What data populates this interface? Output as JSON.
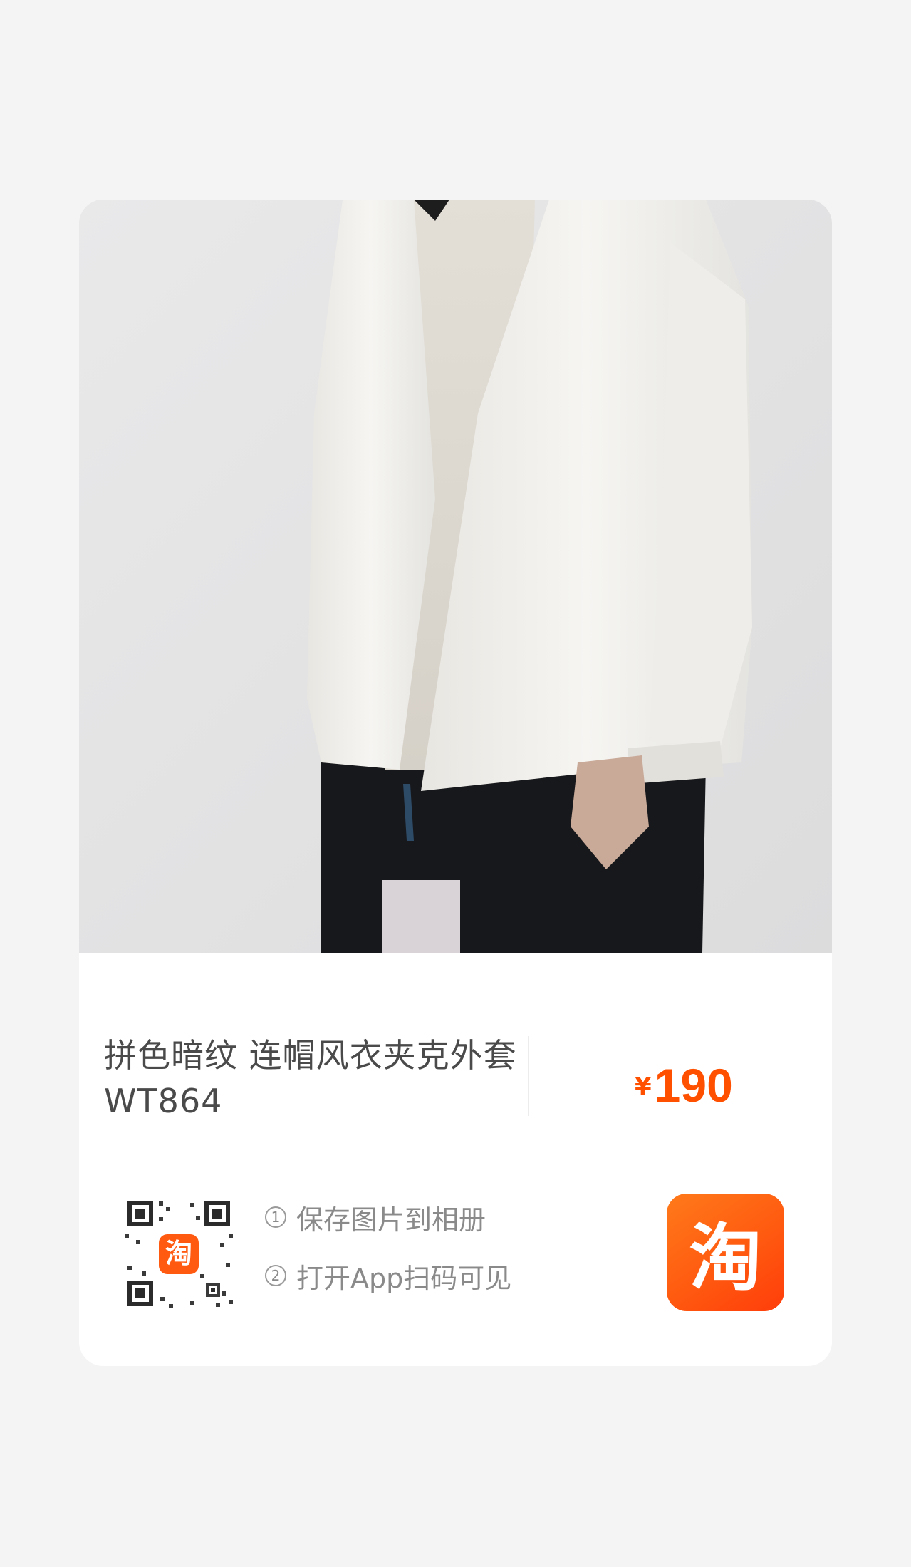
{
  "product": {
    "title": "拼色暗纹 连帽风衣夹克外套 WT864",
    "price_currency": "¥",
    "price_amount": "190"
  },
  "share": {
    "step1_num": "1",
    "step1_text": "保存图片到相册",
    "step2_num": "2",
    "step2_text": "打开App扫码可见",
    "app_icon_char": "淘",
    "qr_logo_char": "淘"
  },
  "colors": {
    "price": "#ff5000",
    "app_icon_bg": "#ff5a10",
    "page_bg": "#f4f4f4"
  }
}
